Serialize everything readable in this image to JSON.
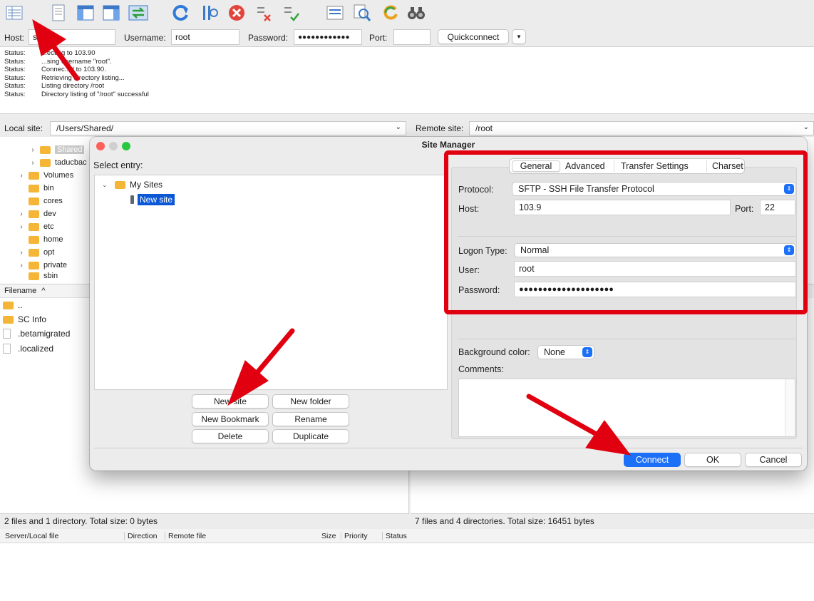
{
  "toolbar": {
    "icons": [
      "site-manager-icon",
      "message-log-icon",
      "local-tree-icon",
      "remote-tree-icon",
      "transfer-queue-icon",
      "refresh-icon",
      "filter-icon",
      "cancel-icon",
      "disconnect-icon",
      "reconnect-icon",
      "compare-icon",
      "search-icon",
      "sync-icon",
      "find-files-icon"
    ]
  },
  "quickconnect": {
    "host_label": "Host:",
    "host_value": "s",
    "username_label": "Username:",
    "username_value": "root",
    "password_label": "Password:",
    "password_value": "●●●●●●●●●●●●",
    "port_label": "Port:",
    "port_value": "",
    "button": "Quickconnect"
  },
  "log": {
    "lines": [
      {
        "label": "Status:",
        "text": "...ecting to 103.90"
      },
      {
        "label": "Status:",
        "text": "...sing username \"root\"."
      },
      {
        "label": "Status:",
        "text": "Connec...d to 103.90."
      },
      {
        "label": "Status:",
        "text": "Retrieving directory listing..."
      },
      {
        "label": "Status:",
        "text": "Listing directory /root"
      },
      {
        "label": "Status:",
        "text": "Directory listing of \"/root\" successful"
      }
    ]
  },
  "local": {
    "label": "Local site:",
    "path": "/Users/Shared/",
    "tree": [
      "Shared",
      "taducbac",
      "Volumes",
      "bin",
      "cores",
      "dev",
      "etc",
      "home",
      "opt",
      "private",
      "sbin"
    ],
    "filename_header": "Filename",
    "files": [
      "..",
      "SC Info",
      ".betamigrated",
      ".localized"
    ],
    "summary": "2 files and 1 directory. Total size: 0 bytes"
  },
  "remote": {
    "label": "Remote site:",
    "path": "/root",
    "summary": "7 files and 4 directories. Total size: 16451 bytes"
  },
  "queue": {
    "columns": [
      "Server/Local file",
      "Direction",
      "Remote file",
      "Size",
      "Priority",
      "Status"
    ]
  },
  "dialog": {
    "title": "Site Manager",
    "select_entry": "Select entry:",
    "root_folder": "My Sites",
    "site": "New site",
    "buttons": {
      "new_site": "New site",
      "new_folder": "New folder",
      "new_bookmark": "New Bookmark",
      "rename": "Rename",
      "delete": "Delete",
      "duplicate": "Duplicate",
      "connect": "Connect",
      "ok": "OK",
      "cancel": "Cancel"
    },
    "tabs": [
      "General",
      "Advanced",
      "Transfer Settings",
      "Charset"
    ],
    "protocol_label": "Protocol:",
    "protocol_value": "SFTP - SSH File Transfer Protocol",
    "host_label": "Host:",
    "host_value": "103.9",
    "port_label": "Port:",
    "port_value": "22",
    "logon_label": "Logon Type:",
    "logon_value": "Normal",
    "user_label": "User:",
    "user_value": "root",
    "password_label": "Password:",
    "password_value": "●●●●●●●●●●●●●●●●●●●●",
    "bgcolor_label": "Background color:",
    "bgcolor_value": "None",
    "comments_label": "Comments:"
  },
  "colors": {
    "accent": "#1c6ff7",
    "annotation": "#e0000f",
    "folder": "#f5b637"
  }
}
